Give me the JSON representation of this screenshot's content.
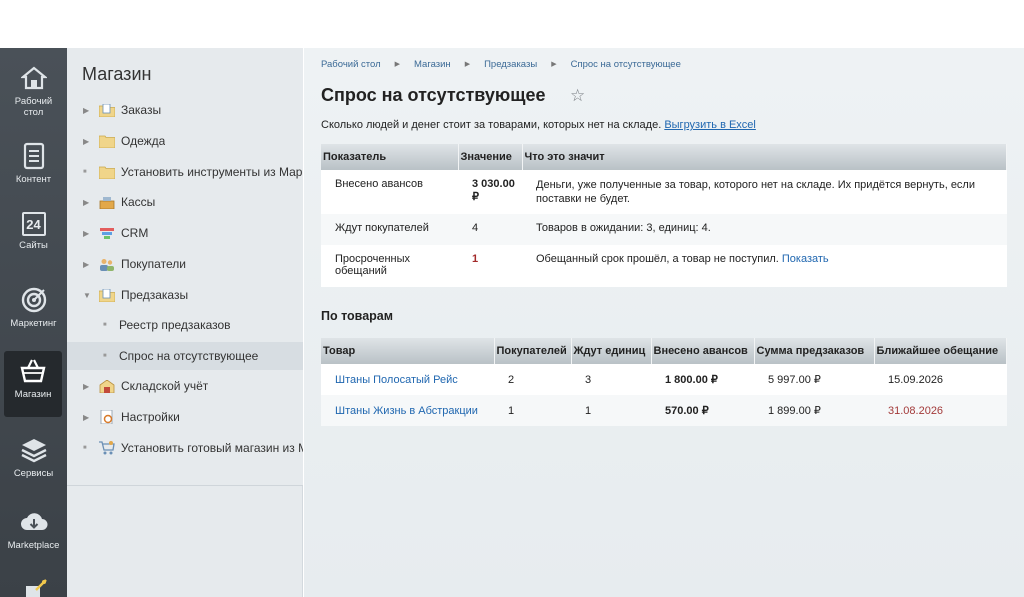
{
  "leftnav": {
    "items": [
      {
        "label": "Рабочий стол",
        "icon": "home-icon"
      },
      {
        "label": "Контент",
        "icon": "document-icon"
      },
      {
        "label": "Сайты",
        "icon": "sites-24-icon"
      },
      {
        "label": "Маркетинг",
        "icon": "target-icon"
      },
      {
        "label": "Магазин",
        "icon": "basket-icon"
      },
      {
        "label": "Сервисы",
        "icon": "layers-icon"
      },
      {
        "label": "Marketplace",
        "icon": "cloud-download-icon"
      }
    ],
    "calendar_day": "24"
  },
  "sidepanel": {
    "title": "Магазин",
    "items": [
      {
        "label": "Заказы",
        "icon": "folder-doc-icon"
      },
      {
        "label": "Одежда",
        "icon": "folder-icon"
      },
      {
        "label": "Установить инструменты из Маркетплейс",
        "icon": "folder-icon"
      },
      {
        "label": "Кассы",
        "icon": "cash-register-icon"
      },
      {
        "label": "CRM",
        "icon": "funnel-icon"
      },
      {
        "label": "Покупатели",
        "icon": "users-icon"
      },
      {
        "label": "Предзаказы",
        "icon": "folder-doc-icon"
      },
      {
        "label": "Реестр предзаказов",
        "icon": ""
      },
      {
        "label": "Спрос на отсутствующее",
        "icon": ""
      },
      {
        "label": "Складской учёт",
        "icon": "warehouse-icon"
      },
      {
        "label": "Настройки",
        "icon": "settings-doc-icon"
      },
      {
        "label": "Установить готовый магазин из Marketplace",
        "icon": "cart-icon"
      }
    ]
  },
  "breadcrumbs": [
    "Рабочий стол",
    "Магазин",
    "Предзаказы",
    "Спрос на отсутствующее"
  ],
  "page": {
    "title": "Спрос на отсутствующее",
    "description": "Сколько людей и денег стоит за товарами, которых нет на складе.",
    "export_link": "Выгрузить в Excel"
  },
  "summary_table": {
    "headers": [
      "Показатель",
      "Значение",
      "Что это значит"
    ],
    "rows": [
      {
        "metric": "Внесено авансов",
        "value": "3 030.00 ₽",
        "meaning": "Деньги, уже полученные за товар, которого нет на складе. Их придётся вернуть, если поставки не будет."
      },
      {
        "metric": "Ждут покупателей",
        "value": "4",
        "meaning": "Товаров в ожидании: 3, единиц: 4."
      },
      {
        "metric": "Просроченных обещаний",
        "value": "1",
        "meaning": "Обещанный срок прошёл, а товар не поступил.",
        "link": "Показать"
      }
    ]
  },
  "products": {
    "title": "По товарам",
    "headers": [
      "Товар",
      "Покупателей",
      "Ждут единиц",
      "Внесено авансов",
      "Сумма предзаказов",
      "Ближайшее обещание"
    ],
    "rows": [
      {
        "name": "Штаны Полосатый Рейс",
        "buyers": "2",
        "units": "3",
        "advance": "1 800.00 ₽",
        "sum": "5 997.00 ₽",
        "promise": "15.09.2026",
        "overdue": false
      },
      {
        "name": "Штаны Жизнь в Абстракции",
        "buyers": "1",
        "units": "1",
        "advance": "570.00 ₽",
        "sum": "1 899.00 ₽",
        "promise": "31.08.2026",
        "overdue": true
      }
    ]
  },
  "colors": {
    "nav_bg": "#4a5158",
    "nav_active": "#25292d",
    "link": "#2067b0",
    "overdue": "#a32a2a"
  }
}
